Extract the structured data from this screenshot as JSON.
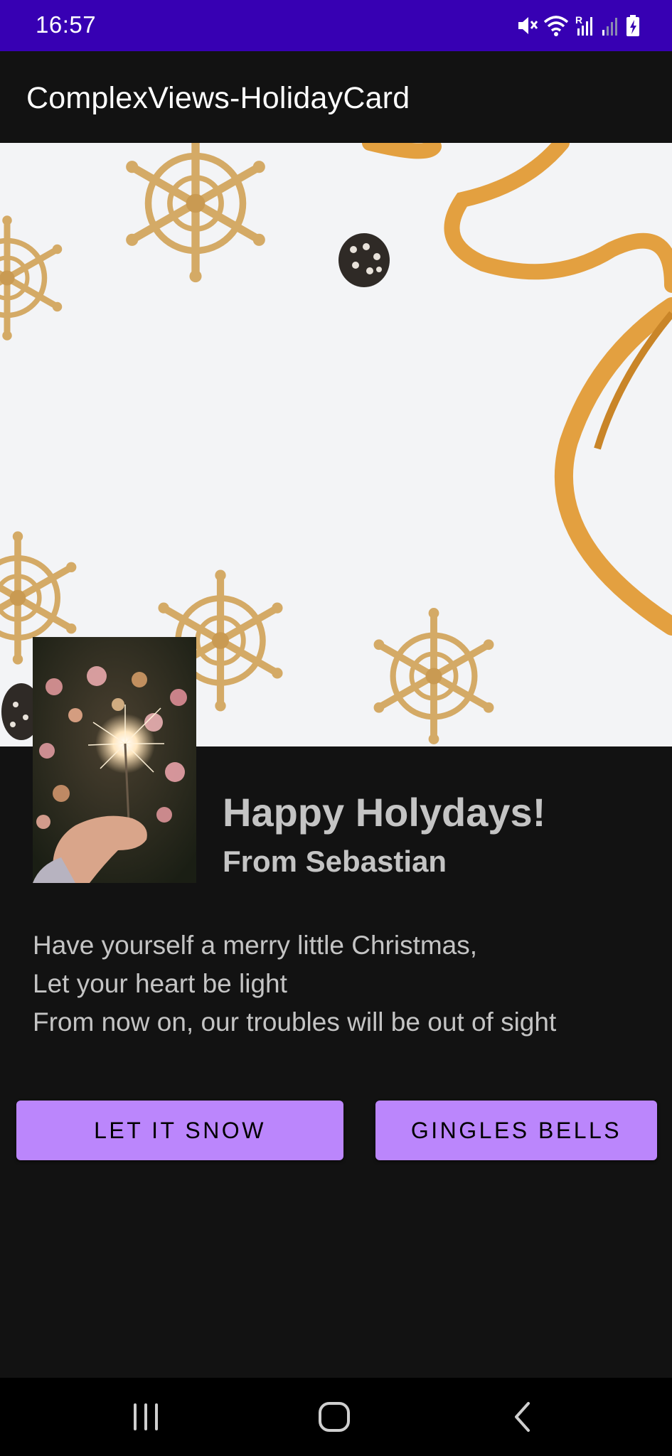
{
  "status_bar": {
    "time": "16:57",
    "background": "#3700b3",
    "icons": [
      "mute-icon",
      "wifi-icon",
      "roaming-signal-icon",
      "signal-icon",
      "battery-charging-icon"
    ],
    "roaming_letter": "R"
  },
  "app_bar": {
    "title": "ComplexViews-HolidayCard"
  },
  "card": {
    "hero_image": "holiday-snowflakes-ribbon-image",
    "thumbnail_image": "sparkler-bokeh-image",
    "greeting": "Happy Holydays!",
    "from": "From Sebastian",
    "message_lines": [
      "Have yourself a merry little Christmas,",
      "Let your heart be light",
      "From now on, our troubles will be out of sight"
    ]
  },
  "buttons": {
    "let_it_snow": "LET IT SNOW",
    "gingles_bells": "GINGLES BELLS",
    "color": "#bb86fc"
  },
  "nav_bar": {
    "icons": [
      "recents-icon",
      "home-icon",
      "back-icon"
    ]
  },
  "colors": {
    "background": "#121212",
    "text": "#c4c4c4",
    "primary_dark": "#3700b3",
    "accent": "#bb86fc"
  }
}
